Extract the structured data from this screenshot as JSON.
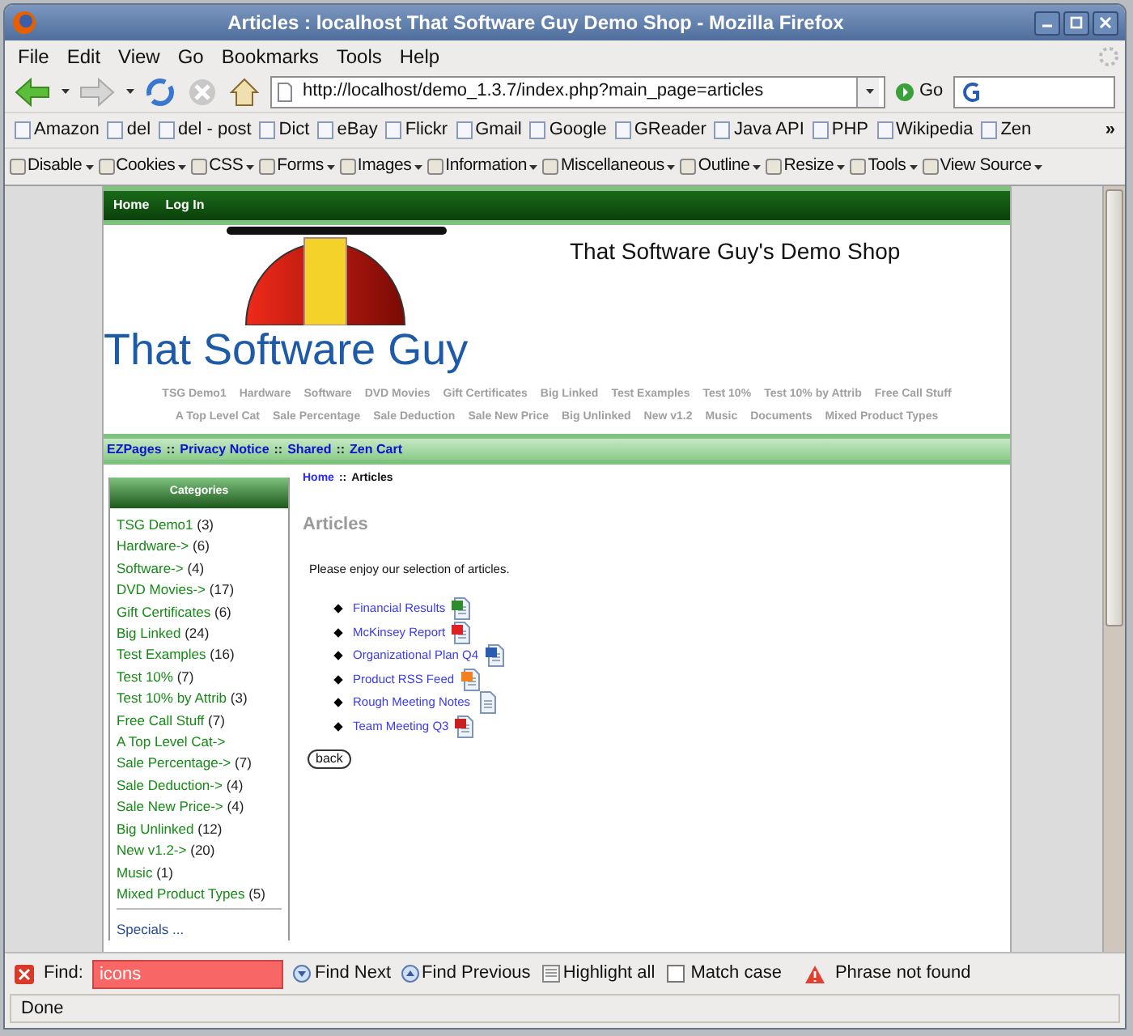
{
  "window": {
    "title": "Articles : localhost That Software Guy Demo Shop - Mozilla Firefox"
  },
  "menu": [
    "File",
    "Edit",
    "View",
    "Go",
    "Bookmarks",
    "Tools",
    "Help"
  ],
  "navigation": {
    "url": "http://localhost/demo_1.3.7/index.php?main_page=articles",
    "go": "Go"
  },
  "bookmarks": [
    "Amazon",
    "del",
    "del - post",
    "Dict",
    "eBay",
    "Flickr",
    "Gmail",
    "Google",
    "GReader",
    "Java API",
    "PHP",
    "Wikipedia",
    "Zen"
  ],
  "bookmarks_overflow": "»",
  "dev_toolbar": [
    "Disable",
    "Cookies",
    "CSS",
    "Forms",
    "Images",
    "Information",
    "Miscellaneous",
    "Outline",
    "Resize",
    "Tools",
    "View Source"
  ],
  "site": {
    "top_nav": [
      "Home",
      "Log In"
    ],
    "shop_title": "That Software Guy's Demo Shop",
    "logo_text": "That Software Guy",
    "category_rows": [
      [
        "TSG Demo1",
        "Hardware",
        "Software",
        "DVD Movies",
        "Gift Certificates",
        "Big Linked",
        "Test Examples",
        "Test 10%",
        "Test 10% by Attrib",
        "Free Call Stuff"
      ],
      [
        "A Top Level Cat",
        "Sale Percentage",
        "Sale Deduction",
        "Sale New Price",
        "Big Unlinked",
        "New v1.2",
        "Music",
        "Documents",
        "Mixed Product Types"
      ]
    ],
    "ezpages": [
      "EZPages",
      "Privacy Notice",
      "Shared",
      "Zen Cart"
    ],
    "ezpages_separator": "::",
    "sidebar": {
      "heading": "Categories",
      "items": [
        {
          "name": "TSG Demo1",
          "count": "(3)"
        },
        {
          "name": "Hardware->",
          "count": "(6)"
        },
        {
          "name": "Software->",
          "count": "(4)"
        },
        {
          "name": "DVD Movies->",
          "count": "(17)"
        },
        {
          "name": "Gift Certificates",
          "count": "(6)"
        },
        {
          "name": "Big Linked",
          "count": "(24)"
        },
        {
          "name": "Test Examples",
          "count": "(16)"
        },
        {
          "name": "Test 10%",
          "count": "(7)"
        },
        {
          "name": "Test 10% by Attrib",
          "count": "(3)"
        },
        {
          "name": "Free Call Stuff",
          "count": "(7)"
        },
        {
          "name": "A Top Level Cat->"
        },
        {
          "name": "Sale Percentage->",
          "count": "(7)"
        },
        {
          "name": "Sale Deduction->",
          "count": "(4)"
        },
        {
          "name": "Sale New Price->",
          "count": "(4)"
        },
        {
          "name": "Big Unlinked",
          "count": "(12)"
        },
        {
          "name": "New v1.2->",
          "count": "(20)"
        },
        {
          "name": "Music",
          "count": "(1)"
        },
        {
          "name": "Mixed Product Types",
          "count": "(5)"
        }
      ],
      "specials": "Specials ..."
    },
    "breadcrumb": {
      "links": [
        "Home"
      ],
      "separator": "::",
      "current": "Articles"
    },
    "heading": "Articles",
    "intro": "Please enjoy our selection of articles.",
    "articles": [
      {
        "title": "Financial Results",
        "kind": "spreadsheet"
      },
      {
        "title": "McKinsey Report",
        "kind": "pdf"
      },
      {
        "title": "Organizational Plan Q4",
        "kind": "document"
      },
      {
        "title": "Product RSS Feed",
        "kind": "feed"
      },
      {
        "title": "Rough Meeting Notes",
        "kind": "text"
      },
      {
        "title": "Team Meeting Q3",
        "kind": "presentation"
      }
    ],
    "back": "back"
  },
  "find_bar": {
    "label": "Find:",
    "value": "icons",
    "not_found": true,
    "find_next": "Find Next",
    "find_previous": "Find Previous",
    "highlight_all": {
      "label": "Highlight all",
      "checked": false
    },
    "match_case": {
      "label": "Match case",
      "checked": false
    },
    "message": "Phrase not found"
  },
  "status_bar": "Done"
}
